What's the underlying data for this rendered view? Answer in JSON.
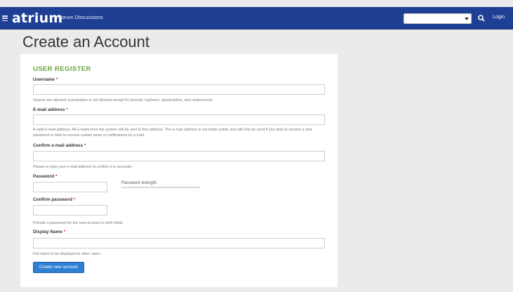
{
  "header": {
    "logo": "atrium",
    "nav_link": "Forum Discussions",
    "space_select": {
      "value": ""
    },
    "login": "Login"
  },
  "page": {
    "title": "Create an Account"
  },
  "form": {
    "section_title": "USER REGISTER",
    "required_marker": "*",
    "fields": [
      {
        "label": "Username",
        "value": "",
        "description": "Spaces are allowed; punctuation is not allowed except for periods, hyphens, apostrophes, and underscores."
      },
      {
        "label": "E-mail address",
        "value": "",
        "description": "A valid e-mail address. All e-mails from the system will be sent to this address. The e-mail address is not made public and will only be used if you wish to receive a new password or wish to receive certain news or notifications by e-mail."
      },
      {
        "label": "Confirm e-mail address",
        "value": "",
        "description": "Please re-type your e-mail address to confirm it is accurate."
      },
      {
        "label": "Password",
        "value": "",
        "description": ""
      },
      {
        "label": "Confirm password",
        "value": "",
        "description": "Provide a password for the new account in both fields."
      },
      {
        "label": "Display Name",
        "value": "",
        "description": "Full name to be displayed to other users"
      }
    ],
    "password_strength_label": "Password strength:",
    "submit_label": "Create new account"
  },
  "colors": {
    "topbar": "#1e3f94",
    "section_title": "#67a33c",
    "required": "#d0312d",
    "button": "#2f7fd3"
  },
  "icons": {
    "menu": "hamburger-icon",
    "search": "search-icon",
    "dropdown": "caret-down-icon"
  }
}
